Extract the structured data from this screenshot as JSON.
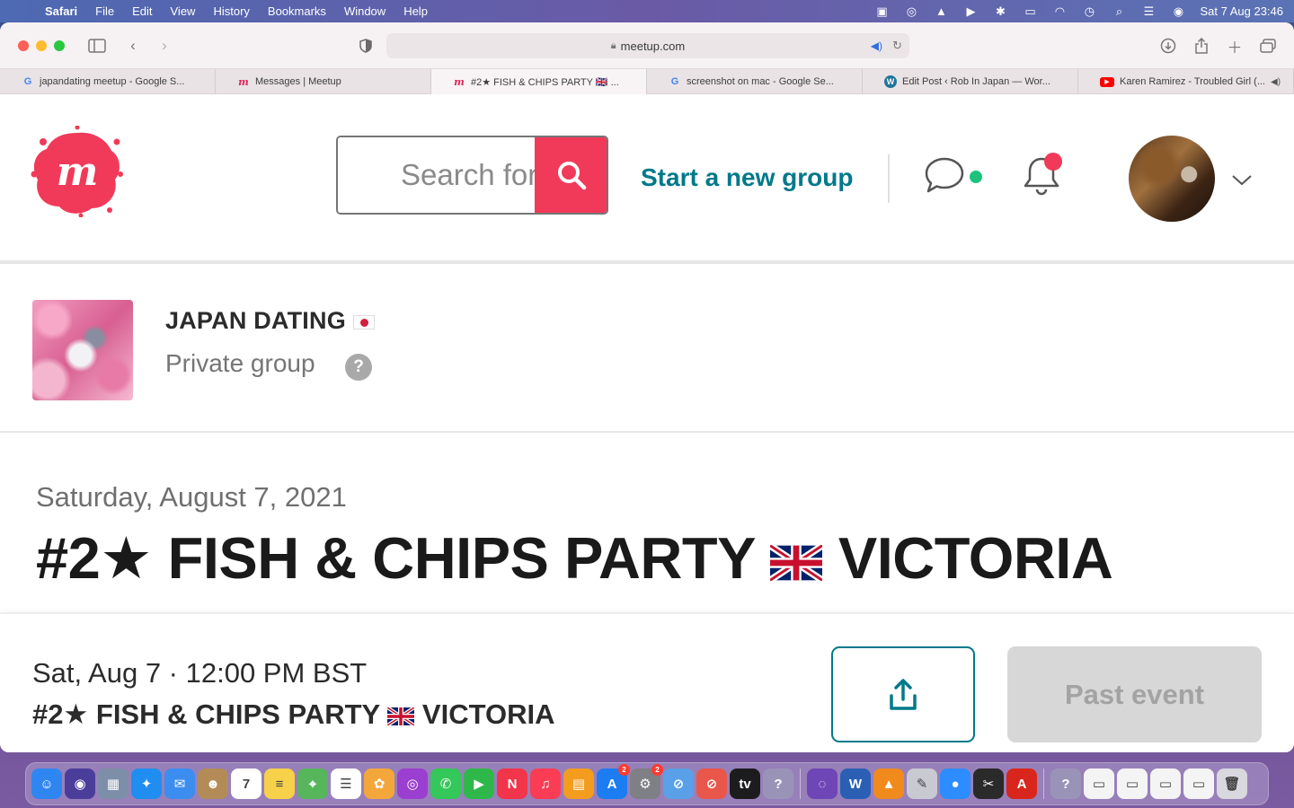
{
  "menubar": {
    "apple_icon": "",
    "app_name": "Safari",
    "menus": [
      "File",
      "Edit",
      "View",
      "History",
      "Bookmarks",
      "Window",
      "Help"
    ],
    "status_icons": [
      "video-icon",
      "dropbox-icon",
      "vlc-icon",
      "play-icon",
      "bluetooth-icon",
      "battery-icon",
      "wifi-icon",
      "time-machine-icon",
      "spotlight-icon",
      "control-center-icon",
      "siri-icon"
    ],
    "clock": "Sat 7 Aug  23:46"
  },
  "browser": {
    "url": "meetup.com",
    "tabs": [
      {
        "favicon": "G",
        "title": "japandating meetup - Google S..."
      },
      {
        "favicon": "m",
        "title": "Messages | Meetup"
      },
      {
        "favicon": "m",
        "title": "#2★ FISH & CHIPS PARTY 🇬🇧 ..."
      },
      {
        "favicon": "G",
        "title": "screenshot on mac - Google Se..."
      },
      {
        "favicon": "W",
        "title": "Edit Post ‹ Rob In Japan — Wor..."
      },
      {
        "favicon": "▶",
        "title": "Karen Ramirez - Troubled Girl (..."
      }
    ]
  },
  "header": {
    "search_placeholder": "Search for",
    "start_group": "Start a new group"
  },
  "group": {
    "name": "JAPAN DATING",
    "privacy": "Private group",
    "help": "?"
  },
  "event": {
    "date": "Saturday, August 7, 2021",
    "title_prefix": "#2★ FISH & CHIPS PARTY",
    "title_suffix": "VICTORIA"
  },
  "footer": {
    "when": "Sat, Aug 7 · 12:00 PM BST",
    "title_prefix": "#2★ FISH & CHIPS PARTY",
    "title_suffix": "VICTORIA",
    "past_label": "Past event"
  },
  "dock": {
    "apps": [
      {
        "name": "finder",
        "color": "#2f86f0",
        "glyph": "☺"
      },
      {
        "name": "siri",
        "color": "#4b3d9a",
        "glyph": "◉"
      },
      {
        "name": "launchpad",
        "color": "#7d8fa8",
        "glyph": "▦"
      },
      {
        "name": "safari",
        "color": "#1f8ef0",
        "glyph": "✦"
      },
      {
        "name": "mail",
        "color": "#3b8df0",
        "glyph": "✉"
      },
      {
        "name": "contacts",
        "color": "#b38b57",
        "glyph": "☻"
      },
      {
        "name": "calendar",
        "color": "#ffffff",
        "glyph": "7"
      },
      {
        "name": "notes",
        "color": "#f7d14a",
        "glyph": "≡"
      },
      {
        "name": "maps",
        "color": "#57b65c",
        "glyph": "⌖"
      },
      {
        "name": "reminders",
        "color": "#ffffff",
        "glyph": "☰"
      },
      {
        "name": "photos",
        "color": "#f3a73b",
        "glyph": "✿"
      },
      {
        "name": "podcasts",
        "color": "#9b3fd0",
        "glyph": "◎"
      },
      {
        "name": "messages",
        "color": "#34c759",
        "glyph": "✆"
      },
      {
        "name": "facetime",
        "color": "#2fb84a",
        "glyph": "▶"
      },
      {
        "name": "news",
        "color": "#f2354b",
        "glyph": "N"
      },
      {
        "name": "music",
        "color": "#fb3c55",
        "glyph": "♫"
      },
      {
        "name": "books",
        "color": "#f39c1e",
        "glyph": "▤"
      },
      {
        "name": "app-store",
        "color": "#1c7cf2",
        "glyph": "A",
        "badge": "2"
      },
      {
        "name": "system-preferences",
        "color": "#7f7f86",
        "glyph": "⚙",
        "badge": "2"
      },
      {
        "name": "no-entry",
        "color": "#5aa0e8",
        "glyph": "⊘"
      },
      {
        "name": "blocker",
        "color": "#e8574a",
        "glyph": "⊘"
      },
      {
        "name": "apple-tv",
        "color": "#1c1c1e",
        "glyph": "tv"
      },
      {
        "name": "unknown-app",
        "color": "#9a93b8",
        "glyph": "?"
      }
    ],
    "apps_right": [
      {
        "name": "tor",
        "color": "#6e46b5",
        "glyph": "◌"
      },
      {
        "name": "word",
        "color": "#2b5fb4",
        "glyph": "W"
      },
      {
        "name": "vlc",
        "color": "#f08a1d",
        "glyph": "▲"
      },
      {
        "name": "preview-tool",
        "color": "#c9c9d2",
        "glyph": "✎"
      },
      {
        "name": "zoom",
        "color": "#2d8cff",
        "glyph": "●"
      },
      {
        "name": "final-cut",
        "color": "#2a2a2a",
        "glyph": "✂"
      },
      {
        "name": "acrobat",
        "color": "#d9261c",
        "glyph": "A"
      }
    ],
    "apps_docs": [
      {
        "name": "unknown-app-2",
        "color": "#9a93b8",
        "glyph": "?"
      },
      {
        "name": "document-1",
        "color": "#f4f4f4",
        "glyph": "▭"
      },
      {
        "name": "document-2",
        "color": "#f4f4f4",
        "glyph": "▭"
      },
      {
        "name": "document-3",
        "color": "#f4f4f4",
        "glyph": "▭"
      },
      {
        "name": "document-4",
        "color": "#f4f4f4",
        "glyph": "▭"
      },
      {
        "name": "trash",
        "color": "#d8d8de",
        "glyph": "🗑"
      }
    ]
  }
}
